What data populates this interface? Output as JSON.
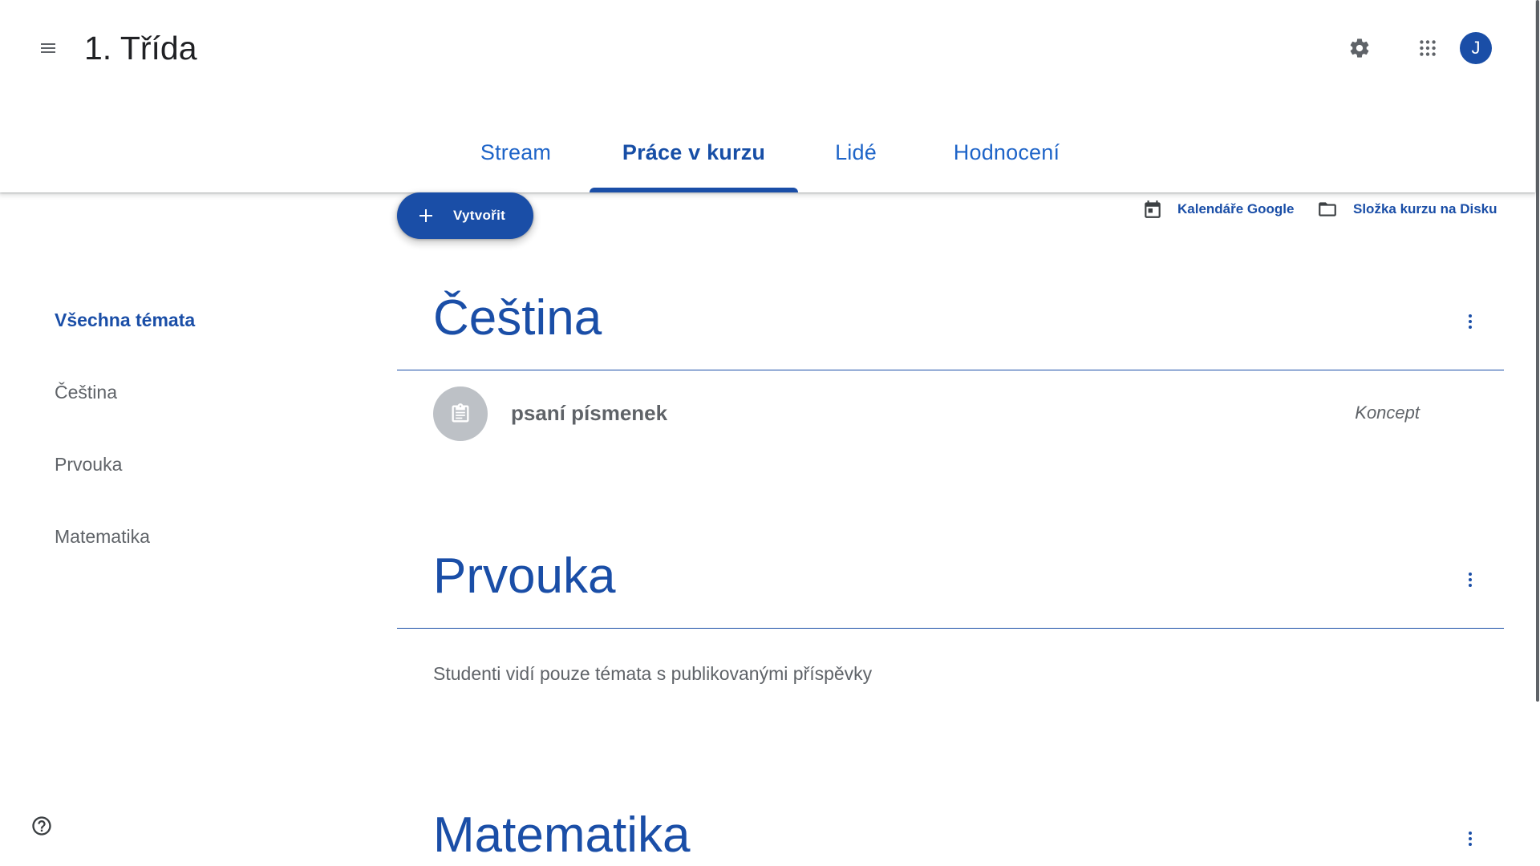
{
  "header": {
    "class_title": "1. Třída",
    "avatar_initial": "J",
    "icons": {
      "menu": "menu-icon",
      "settings": "gear-icon",
      "apps": "apps-grid-icon"
    }
  },
  "tabs": [
    {
      "label": "Stream"
    },
    {
      "label": "Práce v kurzu",
      "active": true
    },
    {
      "label": "Lidé"
    },
    {
      "label": "Hodnocení"
    }
  ],
  "toolbar": {
    "create_label": "Vytvořit",
    "calendar_label": "Kalendáře Google",
    "drive_label": "Složka kurzu na Disku"
  },
  "sidebar": {
    "items": [
      {
        "label": "Všechna témata",
        "active": true
      },
      {
        "label": "Čeština"
      },
      {
        "label": "Prvouka"
      },
      {
        "label": "Matematika"
      }
    ]
  },
  "topics": [
    {
      "title": "Čeština",
      "items": [
        {
          "title": "psaní písmenek",
          "status": "Koncept"
        }
      ]
    },
    {
      "title": "Prvouka",
      "note": "Studenti vidí pouze témata s publikovanými příspěvky"
    },
    {
      "title": "Matematika"
    }
  ],
  "colors": {
    "accent": "#1a4ea7",
    "tab_text": "#1e64c8",
    "muted_text": "#5f6368",
    "assignment_icon_bg": "#bdc1c6"
  }
}
